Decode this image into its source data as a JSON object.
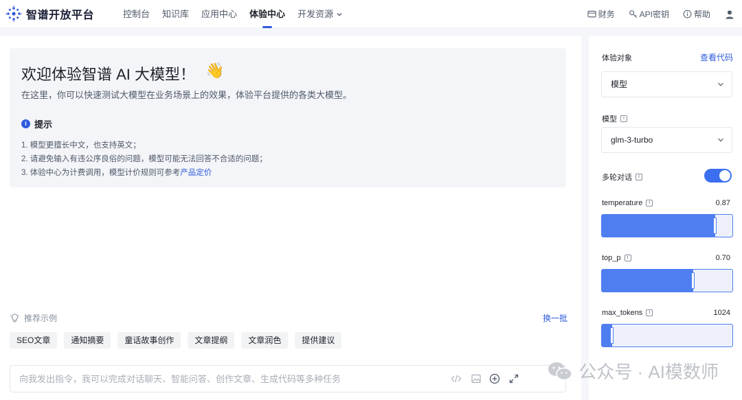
{
  "brand": {
    "name": "智谱开放平台",
    "icon": "zhipu-logo-icon",
    "color": "#2e5bdc"
  },
  "nav": {
    "items": [
      {
        "label": "控制台",
        "active": false
      },
      {
        "label": "知识库",
        "active": false
      },
      {
        "label": "应用中心",
        "active": false
      },
      {
        "label": "体验中心",
        "active": true
      },
      {
        "label": "开发资源",
        "active": false,
        "has_dropdown": true
      }
    ],
    "right": {
      "finance": "财务",
      "api_key": "API密钥",
      "help": "帮助"
    }
  },
  "welcome": {
    "title": "欢迎体验智谱 AI 大模型！",
    "emoji": "👋",
    "subtitle": "在这里，你可以快速测试大模型在业务场景上的效果，体验平台提供的各类大模型。",
    "tip_title": "提示",
    "tips": {
      "t1": "1. 模型更擅长中文，也支持英文；",
      "t2": "2. 请避免输入有违公序良俗的问题，模型可能无法回答不合适的问题；",
      "t3_prefix": "3. 体验中心为计费调用，模型计价规则可参考",
      "t3_link": "产品定价"
    }
  },
  "recommend": {
    "title": "推荐示例",
    "refresh": "换一批",
    "chips": [
      "SEO文章",
      "通知摘要",
      "童话故事创作",
      "文章提纲",
      "文章润色",
      "提供建议"
    ]
  },
  "prompt": {
    "placeholder": "向我发出指令，我可以完成对话聊天、智能问答、创作文章、生成代码等多种任务",
    "value": ""
  },
  "config": {
    "target_label": "体验对象",
    "view_code": "查看代码",
    "target_value": "模型",
    "model_label": "模型",
    "model_value": "glm-3-turbo",
    "multi_turn_label": "多轮对话",
    "multi_turn_on": true,
    "temperature": {
      "label": "temperature",
      "value": "0.87",
      "fraction": 0.87
    },
    "top_p": {
      "label": "top_p",
      "value": "0.70",
      "fraction": 0.7
    },
    "max_tokens": {
      "label": "max_tokens",
      "value": "1024",
      "fraction": 0.08
    }
  },
  "watermark": {
    "text": "公众号 · AI模数师",
    "icon": "wechat-icon"
  }
}
